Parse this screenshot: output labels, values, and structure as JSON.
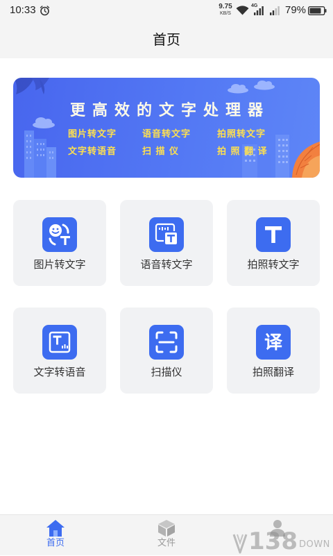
{
  "status_bar": {
    "time": "10:33",
    "net_speed_value": "9.75",
    "net_speed_unit": "KB/S",
    "network": "4G",
    "battery": "79%",
    "icons": [
      "alarm-icon",
      "wifi-icon",
      "signal-icon",
      "signal-icon",
      "battery-icon"
    ]
  },
  "header": {
    "title": "首页"
  },
  "banner": {
    "title": "更高效的文字处理器",
    "features": [
      "图片转文字",
      "语音转文字",
      "拍照转文字",
      "文字转语音",
      "扫 描 仪",
      "拍 照 翻 译"
    ]
  },
  "tools": [
    {
      "label": "图片转文字",
      "icon": "image-to-text-icon"
    },
    {
      "label": "语音转文字",
      "icon": "voice-to-text-icon"
    },
    {
      "label": "拍照转文字",
      "icon": "photo-to-text-icon"
    },
    {
      "label": "文字转语音",
      "icon": "text-to-speech-icon"
    },
    {
      "label": "扫描仪",
      "icon": "scanner-icon"
    },
    {
      "label": "拍照翻译",
      "icon": "translate-icon",
      "glyph": "译"
    }
  ],
  "bottom_nav": [
    {
      "label": "首页",
      "icon": "home-icon",
      "active": true
    },
    {
      "label": "文件",
      "icon": "cube-icon",
      "active": false
    },
    {
      "icon": "person-icon",
      "active": false
    }
  ],
  "watermark": {
    "number": "138",
    "text": "DOWN"
  },
  "colors": {
    "accent": "#3d6cf0",
    "banner_feature": "#ffe14f",
    "nav_inactive": "#9a9a9a"
  }
}
